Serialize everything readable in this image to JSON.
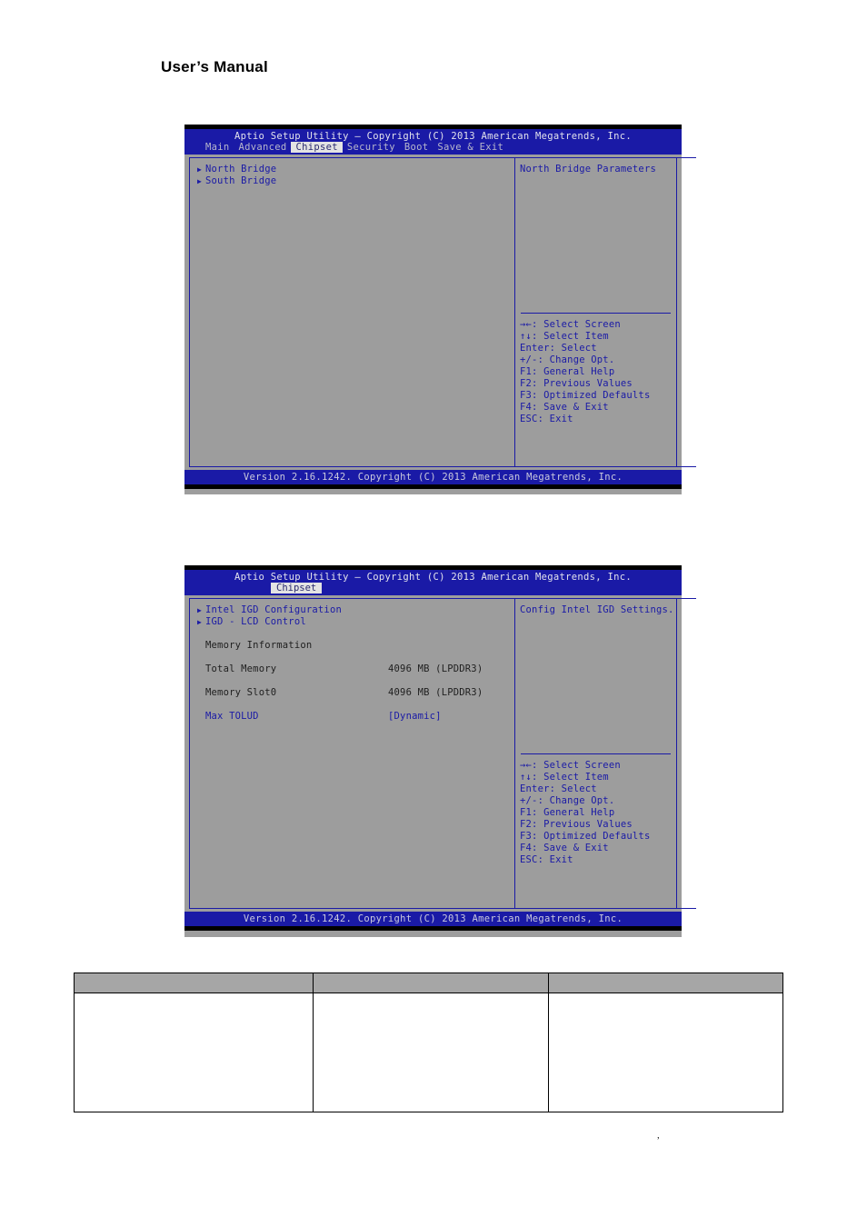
{
  "page": {
    "heading": "User’s Manual",
    "footer_mark": ","
  },
  "bios_screens": [
    {
      "id": "chipset-main",
      "title": "Aptio Setup Utility – Copyright (C) 2013 American Megatrends, Inc.",
      "menu": [
        {
          "label": "Main",
          "active": false
        },
        {
          "label": "Advanced",
          "active": false
        },
        {
          "label": "Chipset",
          "active": true
        },
        {
          "label": "Security",
          "active": false
        },
        {
          "label": "Boot",
          "active": false
        },
        {
          "label": "Save & Exit",
          "active": false
        }
      ],
      "items": [
        {
          "label": "North Bridge",
          "arrow": true
        },
        {
          "label": "South Bridge",
          "arrow": true
        }
      ],
      "help_description": "North Bridge Parameters",
      "help_keys": [
        "→←: Select Screen",
        "↑↓: Select Item",
        "Enter: Select",
        "+/-: Change Opt.",
        "F1: General Help",
        "F2: Previous Values",
        "F3: Optimized Defaults",
        "F4: Save & Exit",
        "ESC: Exit"
      ],
      "version": "Version 2.16.1242. Copyright (C) 2013 American Megatrends, Inc."
    },
    {
      "id": "chipset-north-bridge",
      "title": "Aptio Setup Utility – Copyright (C) 2013 American Megatrends, Inc.",
      "menu": [
        {
          "label": "Chipset",
          "active": true
        }
      ],
      "items": [
        {
          "label": "Intel IGD Configuration",
          "arrow": true
        },
        {
          "label": "IGD - LCD Control",
          "arrow": true
        }
      ],
      "section_title": "Memory Information",
      "rows": [
        {
          "label": "Total Memory",
          "value": "4096 MB (LPDDR3)",
          "link": false
        },
        {
          "label": "Memory Slot0",
          "value": "4096 MB (LPDDR3)",
          "link": false
        },
        {
          "label": "Max TOLUD",
          "value": "[Dynamic]",
          "link": true
        }
      ],
      "help_description": "Config Intel IGD Settings.",
      "help_keys": [
        "→←: Select Screen",
        "↑↓: Select Item",
        "Enter: Select",
        "+/-: Change Opt.",
        "F1: General Help",
        "F2: Previous Values",
        "F3: Optimized Defaults",
        "F4: Save & Exit",
        "ESC: Exit"
      ],
      "version": "Version 2.16.1242. Copyright (C) 2013 American Megatrends, Inc."
    }
  ],
  "table": {
    "headers": [
      "",
      "",
      ""
    ],
    "rows": [
      [
        "",
        "",
        ""
      ]
    ]
  }
}
